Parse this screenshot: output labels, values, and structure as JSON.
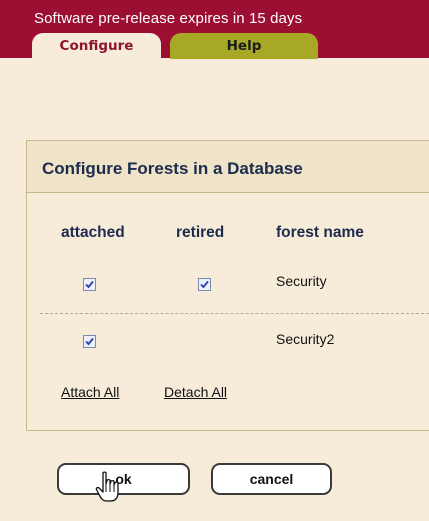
{
  "banner": {
    "text": "Software pre-release expires in 15 days"
  },
  "tabs": [
    {
      "label": "Configure",
      "active": true
    },
    {
      "label": "Help",
      "active": false
    }
  ],
  "panel": {
    "title": "Configure Forests in a Database",
    "columns": {
      "attached": "attached",
      "retired": "retired",
      "forest_name": "forest name"
    },
    "rows": [
      {
        "forest_name": "Security",
        "attached": true,
        "retired": true
      },
      {
        "forest_name": "Security2",
        "attached": true,
        "retired": null
      }
    ],
    "links": {
      "attach_all": "Attach All",
      "detach_all": "Detach All"
    }
  },
  "buttons": {
    "ok": "ok",
    "cancel": "cancel"
  },
  "colors": {
    "topbar": "#9c0f33",
    "background": "#f6ecd9",
    "help_tab": "#a6a826",
    "title_text": "#1d2b4f"
  }
}
